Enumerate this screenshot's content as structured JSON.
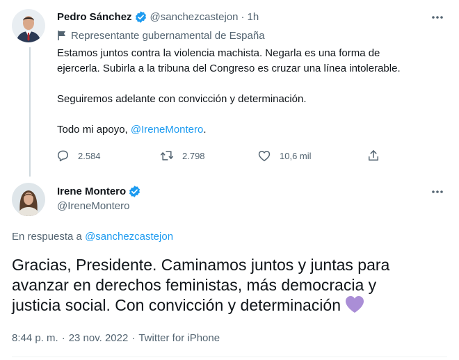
{
  "parent_tweet": {
    "author": {
      "name": "Pedro Sánchez",
      "handle": "@sanchezcastejon",
      "verified": true
    },
    "separator": "·",
    "time": "1h",
    "label": "Representante gubernamental de España",
    "label_icon": "flag-icon",
    "body": {
      "line_1": "Estamos juntos contra la violencia machista. Negarla es una forma de",
      "line_2": "ejercerla. Subirla a la tribuna del Congreso es cruzar una línea intolerable.",
      "line_3": "Seguiremos adelante con convicción y determinación.",
      "line_4_prefix": "Todo mi apoyo, ",
      "line_4_mention": "@IreneMontero",
      "line_4_suffix": "."
    },
    "actions": {
      "replies": "2.584",
      "retweets": "2.798",
      "likes": "10,6 mil"
    }
  },
  "focused_tweet": {
    "author": {
      "name": "Irene Montero",
      "handle": "@IreneMontero",
      "verified": true
    },
    "reply_to_prefix": "En respuesta a",
    "reply_to_handle": "@sanchezcastejon",
    "body": {
      "line_1": "Gracias, Presidente. Caminamos juntos y juntas para",
      "line_2": "avanzar en derechos feministas, más democracia y",
      "line_3": "justicia social. Con convicción y determinación"
    },
    "emoji": "purple-heart",
    "time": "8:44 p. m.",
    "date": "23 nov. 2022",
    "source": "Twitter for iPhone",
    "meta_separator": "·"
  },
  "colors": {
    "text": "#0f1419",
    "secondary": "#536471",
    "link": "#1d9bf0",
    "verified": "#1d9bf0",
    "thread_line": "#cfd9de",
    "heart": "#aa8ed6"
  }
}
